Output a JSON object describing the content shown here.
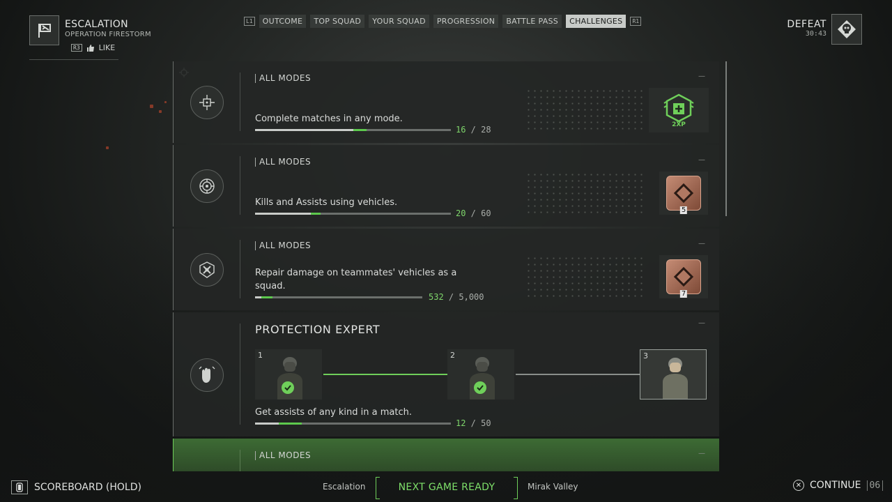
{
  "header": {
    "mode_title": "ESCALATION",
    "mode_subtitle": "OPERATION FIRESTORM",
    "like_key": "R3",
    "like_label": "LIKE",
    "result": "DEFEAT",
    "time": "30:43"
  },
  "tabs": {
    "left_key": "L1",
    "right_key": "R1",
    "items": [
      "OUTCOME",
      "TOP SQUAD",
      "YOUR SQUAD",
      "PROGRESSION",
      "BATTLE PASS",
      "CHALLENGES"
    ],
    "active": "CHALLENGES"
  },
  "challenges": [
    {
      "modes": "ALL MODES",
      "description": "Complete matches in any mode.",
      "current": "16",
      "total": "28",
      "progress": 0.571,
      "gain": 0.07,
      "reward": "2XP",
      "reward_type": "xp-boost"
    },
    {
      "modes": "ALL MODES",
      "description": "Kills and Assists using vehicles.",
      "current": "20",
      "total": "60",
      "progress": 0.333,
      "gain": 0.05,
      "reward": "5",
      "reward_type": "bronze-diamond-badge"
    },
    {
      "modes": "ALL MODES",
      "description": "Repair damage on teammates' vehicles as a squad.",
      "current": "532",
      "total": "5,000",
      "progress": 0.106,
      "gain": 0.07,
      "reward": "7",
      "reward_type": "bronze-diamond-badge"
    },
    {
      "title": "PROTECTION EXPERT",
      "description": "Get assists of any kind in a match.",
      "current": "12",
      "total": "50",
      "progress": 0.24,
      "gain": 0.12,
      "tiers": [
        "1",
        "2",
        "3"
      ]
    },
    {
      "modes": "ALL MODES"
    }
  ],
  "footer": {
    "scoreboard_label": "SCOREBOARD (HOLD)",
    "current_mode": "Escalation",
    "next_label": "NEXT GAME READY",
    "next_map": "Mirak Valley",
    "continue_label": "CONTINUE",
    "countdown": "06"
  },
  "colors": {
    "accent_green": "#6fcf5a",
    "active_tab": "#c8cbc8",
    "bronze": "#b07862"
  }
}
